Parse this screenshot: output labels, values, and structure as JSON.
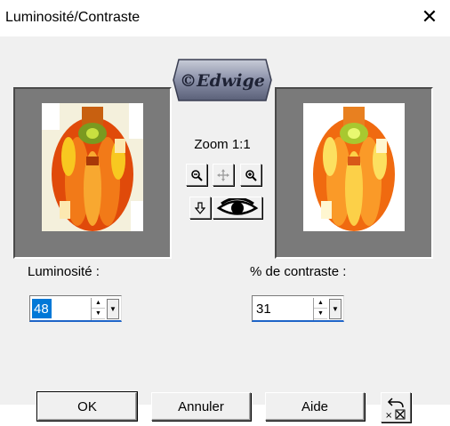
{
  "window": {
    "title": "Luminosité/Contraste",
    "close_glyph": "✕"
  },
  "watermark": {
    "text": "©Edwige"
  },
  "zoom": {
    "label": "Zoom 1:1",
    "tools": [
      {
        "name": "zoom-out-icon",
        "glyph": "🔍"
      },
      {
        "name": "pan-icon",
        "glyph": "✥"
      },
      {
        "name": "zoom-in-icon",
        "glyph": "🔍"
      },
      {
        "name": "arrow-down-icon",
        "glyph": "⇩"
      },
      {
        "name": "eye-icon",
        "glyph": "👁"
      }
    ]
  },
  "brightness": {
    "label": "Luminosité :",
    "value": "48"
  },
  "contrast": {
    "label": "% de contraste :",
    "value": "31"
  },
  "buttons": {
    "ok": "OK",
    "cancel": "Annuler",
    "help": "Aide"
  },
  "colors": {
    "preview_bg": "#7a7a7a",
    "accent": "#0078d7",
    "flower_orange": "#f06a10",
    "flower_yellow": "#f8c820",
    "flower_green": "#7a9a20"
  }
}
